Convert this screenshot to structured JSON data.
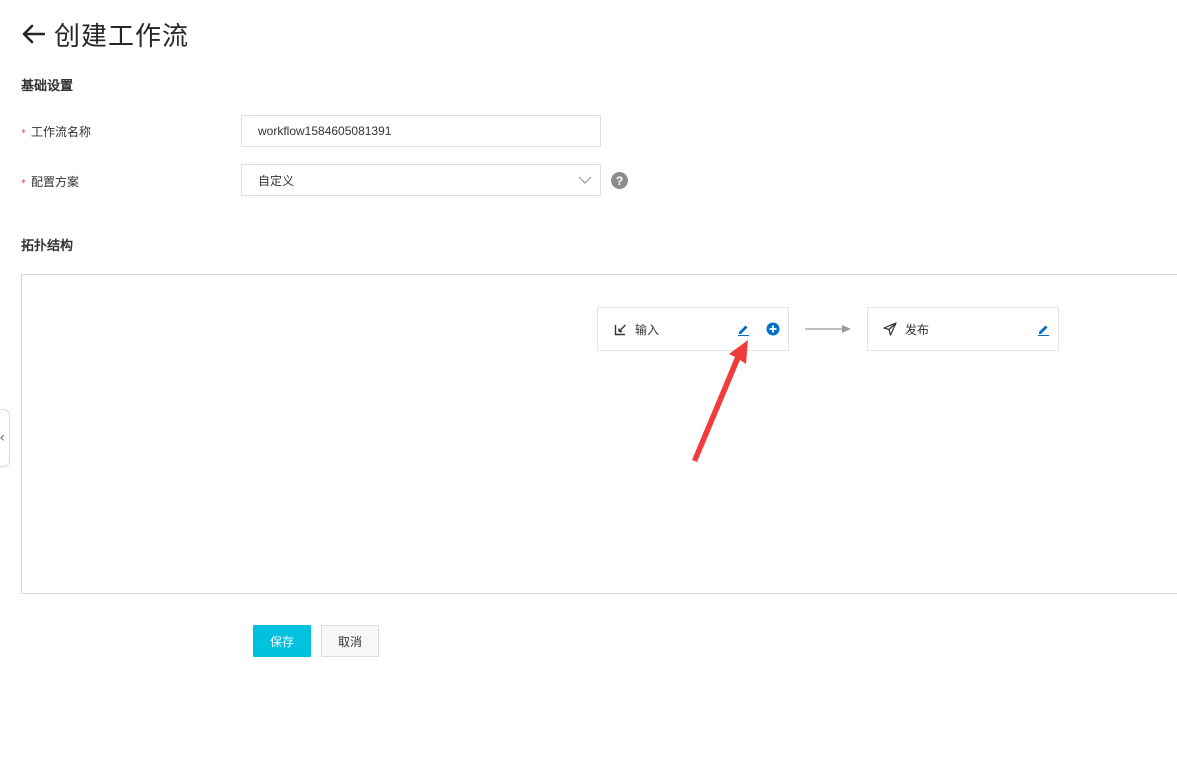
{
  "header": {
    "title": "创建工作流"
  },
  "basic_settings": {
    "section_title": "基础设置",
    "name_field": {
      "label": "工作流名称",
      "required_mark": "*",
      "value": "workflow1584605081391"
    },
    "config_field": {
      "label": "配置方案",
      "required_mark": "*",
      "value": "自定义",
      "help_glyph": "?"
    }
  },
  "topology": {
    "section_title": "拓扑结构",
    "collapse_glyph": "‹",
    "nodes": [
      {
        "label": "输入",
        "icon": "input-edit-icon",
        "actions": [
          "edit-pencil-icon",
          "add-circle-icon"
        ]
      },
      {
        "label": "发布",
        "icon": "publish-send-icon",
        "actions": [
          "edit-pencil-icon"
        ]
      }
    ]
  },
  "actions": {
    "save_label": "保存",
    "cancel_label": "取消"
  },
  "colors": {
    "primary": "#00c1de",
    "link_blue": "#0070cc",
    "annotation_red": "#f03c3c",
    "required_red": "#e0483e"
  }
}
